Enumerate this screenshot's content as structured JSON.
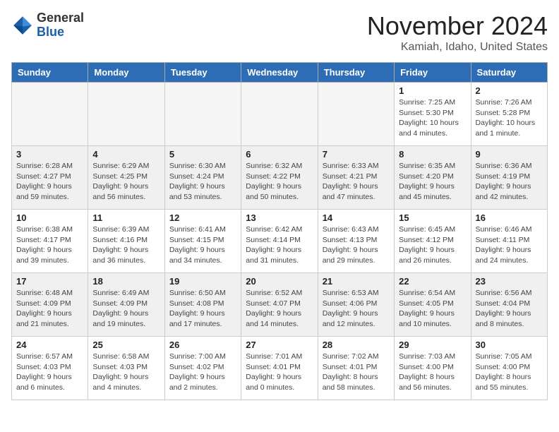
{
  "logo": {
    "general": "General",
    "blue": "Blue"
  },
  "title": "November 2024",
  "location": "Kamiah, Idaho, United States",
  "days_of_week": [
    "Sunday",
    "Monday",
    "Tuesday",
    "Wednesday",
    "Thursday",
    "Friday",
    "Saturday"
  ],
  "weeks": [
    [
      {
        "day": "",
        "info": ""
      },
      {
        "day": "",
        "info": ""
      },
      {
        "day": "",
        "info": ""
      },
      {
        "day": "",
        "info": ""
      },
      {
        "day": "",
        "info": ""
      },
      {
        "day": "1",
        "info": "Sunrise: 7:25 AM\nSunset: 5:30 PM\nDaylight: 10 hours\nand 4 minutes."
      },
      {
        "day": "2",
        "info": "Sunrise: 7:26 AM\nSunset: 5:28 PM\nDaylight: 10 hours\nand 1 minute."
      }
    ],
    [
      {
        "day": "3",
        "info": "Sunrise: 6:28 AM\nSunset: 4:27 PM\nDaylight: 9 hours\nand 59 minutes."
      },
      {
        "day": "4",
        "info": "Sunrise: 6:29 AM\nSunset: 4:25 PM\nDaylight: 9 hours\nand 56 minutes."
      },
      {
        "day": "5",
        "info": "Sunrise: 6:30 AM\nSunset: 4:24 PM\nDaylight: 9 hours\nand 53 minutes."
      },
      {
        "day": "6",
        "info": "Sunrise: 6:32 AM\nSunset: 4:22 PM\nDaylight: 9 hours\nand 50 minutes."
      },
      {
        "day": "7",
        "info": "Sunrise: 6:33 AM\nSunset: 4:21 PM\nDaylight: 9 hours\nand 47 minutes."
      },
      {
        "day": "8",
        "info": "Sunrise: 6:35 AM\nSunset: 4:20 PM\nDaylight: 9 hours\nand 45 minutes."
      },
      {
        "day": "9",
        "info": "Sunrise: 6:36 AM\nSunset: 4:19 PM\nDaylight: 9 hours\nand 42 minutes."
      }
    ],
    [
      {
        "day": "10",
        "info": "Sunrise: 6:38 AM\nSunset: 4:17 PM\nDaylight: 9 hours\nand 39 minutes."
      },
      {
        "day": "11",
        "info": "Sunrise: 6:39 AM\nSunset: 4:16 PM\nDaylight: 9 hours\nand 36 minutes."
      },
      {
        "day": "12",
        "info": "Sunrise: 6:41 AM\nSunset: 4:15 PM\nDaylight: 9 hours\nand 34 minutes."
      },
      {
        "day": "13",
        "info": "Sunrise: 6:42 AM\nSunset: 4:14 PM\nDaylight: 9 hours\nand 31 minutes."
      },
      {
        "day": "14",
        "info": "Sunrise: 6:43 AM\nSunset: 4:13 PM\nDaylight: 9 hours\nand 29 minutes."
      },
      {
        "day": "15",
        "info": "Sunrise: 6:45 AM\nSunset: 4:12 PM\nDaylight: 9 hours\nand 26 minutes."
      },
      {
        "day": "16",
        "info": "Sunrise: 6:46 AM\nSunset: 4:11 PM\nDaylight: 9 hours\nand 24 minutes."
      }
    ],
    [
      {
        "day": "17",
        "info": "Sunrise: 6:48 AM\nSunset: 4:09 PM\nDaylight: 9 hours\nand 21 minutes."
      },
      {
        "day": "18",
        "info": "Sunrise: 6:49 AM\nSunset: 4:09 PM\nDaylight: 9 hours\nand 19 minutes."
      },
      {
        "day": "19",
        "info": "Sunrise: 6:50 AM\nSunset: 4:08 PM\nDaylight: 9 hours\nand 17 minutes."
      },
      {
        "day": "20",
        "info": "Sunrise: 6:52 AM\nSunset: 4:07 PM\nDaylight: 9 hours\nand 14 minutes."
      },
      {
        "day": "21",
        "info": "Sunrise: 6:53 AM\nSunset: 4:06 PM\nDaylight: 9 hours\nand 12 minutes."
      },
      {
        "day": "22",
        "info": "Sunrise: 6:54 AM\nSunset: 4:05 PM\nDaylight: 9 hours\nand 10 minutes."
      },
      {
        "day": "23",
        "info": "Sunrise: 6:56 AM\nSunset: 4:04 PM\nDaylight: 9 hours\nand 8 minutes."
      }
    ],
    [
      {
        "day": "24",
        "info": "Sunrise: 6:57 AM\nSunset: 4:03 PM\nDaylight: 9 hours\nand 6 minutes."
      },
      {
        "day": "25",
        "info": "Sunrise: 6:58 AM\nSunset: 4:03 PM\nDaylight: 9 hours\nand 4 minutes."
      },
      {
        "day": "26",
        "info": "Sunrise: 7:00 AM\nSunset: 4:02 PM\nDaylight: 9 hours\nand 2 minutes."
      },
      {
        "day": "27",
        "info": "Sunrise: 7:01 AM\nSunset: 4:01 PM\nDaylight: 9 hours\nand 0 minutes."
      },
      {
        "day": "28",
        "info": "Sunrise: 7:02 AM\nSunset: 4:01 PM\nDaylight: 8 hours\nand 58 minutes."
      },
      {
        "day": "29",
        "info": "Sunrise: 7:03 AM\nSunset: 4:00 PM\nDaylight: 8 hours\nand 56 minutes."
      },
      {
        "day": "30",
        "info": "Sunrise: 7:05 AM\nSunset: 4:00 PM\nDaylight: 8 hours\nand 55 minutes."
      }
    ]
  ]
}
